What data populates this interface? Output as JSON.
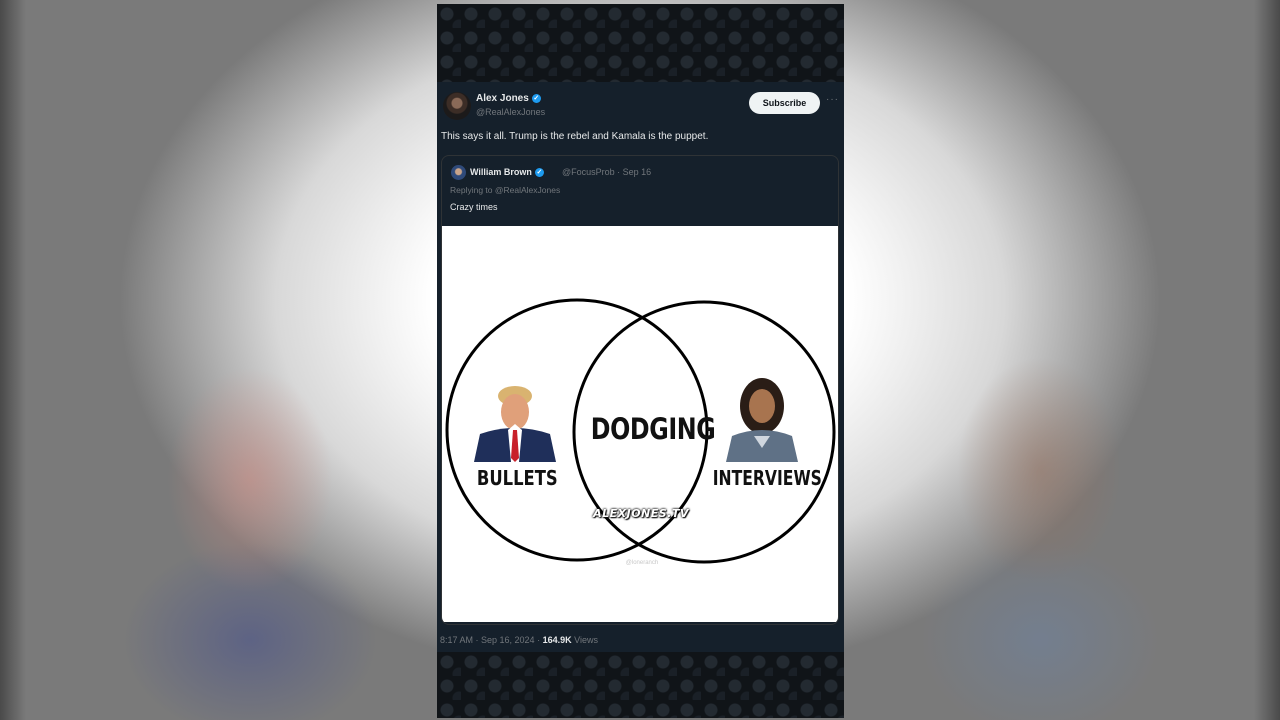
{
  "tweet": {
    "author_name": "Alex Jones",
    "author_handle": "@RealAlexJones",
    "subscribe_label": "Subscribe",
    "more_label": "···",
    "verified_icon": "verified-badge-icon",
    "text": "This says it all. Trump is the rebel and Kamala is the puppet.",
    "timestamp": "8:17 AM · Sep 16, 2024 · ",
    "views_count": "164.9K",
    "views_label": " Views"
  },
  "quote": {
    "author_name": "William Brown",
    "author_handle": "@FocusProb · Sep 16",
    "replying_to": "Replying to @RealAlexJones",
    "text": "Crazy times"
  },
  "meme": {
    "center_label": "DODGING",
    "left_label": "BULLETS",
    "right_label": "INTERVIEWS",
    "watermark": "ALEXJONES.TV",
    "credit": "@loneranch"
  },
  "colors": {
    "tweet_bg": "#15202b",
    "verified": "#1d9bf0",
    "text_primary": "#e7e9ea",
    "text_secondary": "#71767b"
  }
}
